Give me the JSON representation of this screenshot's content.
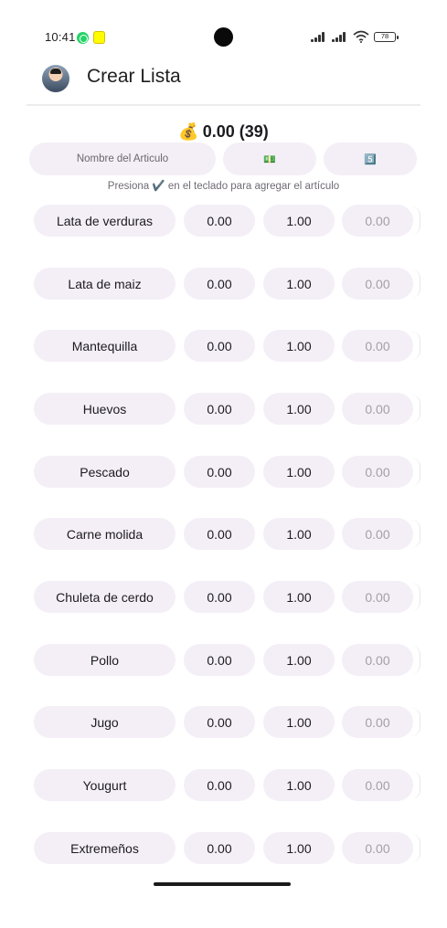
{
  "status_bar": {
    "time": "10:41",
    "battery": "78"
  },
  "app_bar": {
    "title": "Crear Lista"
  },
  "summary": {
    "icon": "💰",
    "total": "0.00 (39)"
  },
  "inputs": {
    "name_placeholder": "Nombre del Articulo",
    "price_placeholder": "💵",
    "qty_placeholder": "5️⃣"
  },
  "hint": "Presiona ✔️ en el teclado para agregar el artículo",
  "items": [
    {
      "name": "Lata de verduras",
      "price": "0.00",
      "qty": "1.00",
      "subtotal": "0.00"
    },
    {
      "name": "Lata de maiz",
      "price": "0.00",
      "qty": "1.00",
      "subtotal": "0.00"
    },
    {
      "name": "Mantequilla",
      "price": "0.00",
      "qty": "1.00",
      "subtotal": "0.00"
    },
    {
      "name": "Huevos",
      "price": "0.00",
      "qty": "1.00",
      "subtotal": "0.00"
    },
    {
      "name": "Pescado",
      "price": "0.00",
      "qty": "1.00",
      "subtotal": "0.00"
    },
    {
      "name": "Carne molida",
      "price": "0.00",
      "qty": "1.00",
      "subtotal": "0.00"
    },
    {
      "name": "Chuleta de cerdo",
      "price": "0.00",
      "qty": "1.00",
      "subtotal": "0.00"
    },
    {
      "name": "Pollo",
      "price": "0.00",
      "qty": "1.00",
      "subtotal": "0.00"
    },
    {
      "name": "Jugo",
      "price": "0.00",
      "qty": "1.00",
      "subtotal": "0.00"
    },
    {
      "name": "Yougurt",
      "price": "0.00",
      "qty": "1.00",
      "subtotal": "0.00"
    },
    {
      "name": "Extremeños",
      "price": "0.00",
      "qty": "1.00",
      "subtotal": "0.00"
    }
  ],
  "colors": {
    "field_bg": "#f4eff6",
    "text": "#1c1b1f",
    "muted": "#a29fa6"
  }
}
